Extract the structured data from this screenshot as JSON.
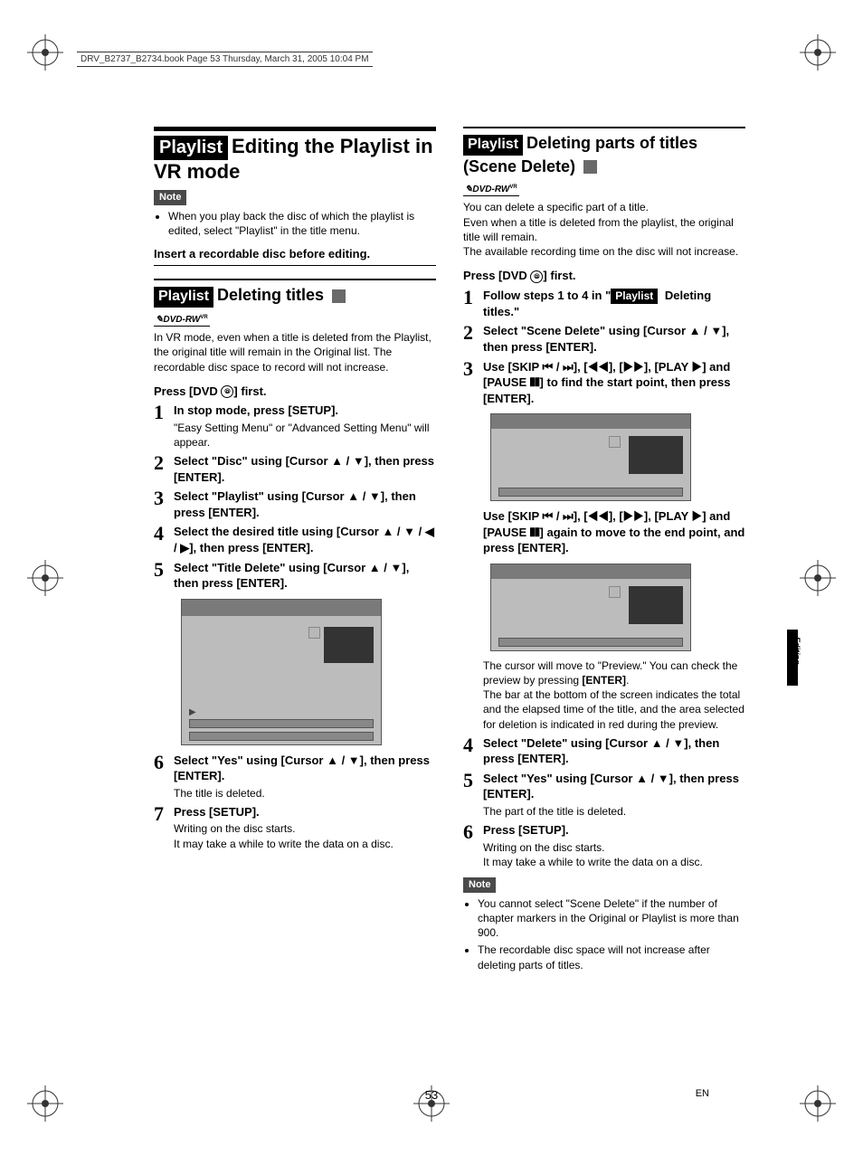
{
  "header_line": "DRV_B2737_B2734.book  Page 53  Thursday, March 31, 2005  10:04 PM",
  "footer": {
    "pagenum": "53",
    "lang": "EN"
  },
  "side_tab": "Editing",
  "left": {
    "title_badge": "Playlist",
    "title": "Editing the Playlist in VR mode",
    "note_label": "Note",
    "note_bullets": [
      "When you play back the disc of which the playlist is edited, select \"Playlist\" in the title menu."
    ],
    "insert_disc": "Insert a recordable disc before editing.",
    "sub_badge": "Playlist",
    "sub_title": "Deleting titles",
    "media_label": "DVD-RW",
    "media_mode": "VR",
    "vrmode_text": "In VR mode, even when a title is deleted from the Playlist, the original title will remain in the Original list. The recordable disc space to record will not increase.",
    "press_dvd": "Press [DVD ⦿] first.",
    "steps": [
      {
        "n": "1",
        "head": "In stop mode, press [SETUP].",
        "sub": "\"Easy Setting Menu\" or \"Advanced Setting Menu\" will appear."
      },
      {
        "n": "2",
        "head": "Select \"Disc\" using [Cursor ▲ / ▼], then press [ENTER].",
        "sub": ""
      },
      {
        "n": "3",
        "head": "Select \"Playlist\" using [Cursor ▲ / ▼], then press [ENTER].",
        "sub": ""
      },
      {
        "n": "4",
        "head": "Select the desired title using [Cursor ▲ / ▼ / ◀ / ▶], then press [ENTER].",
        "sub": ""
      },
      {
        "n": "5",
        "head": "Select \"Title Delete\" using [Cursor ▲ / ▼], then press [ENTER].",
        "sub": ""
      },
      {
        "n": "6",
        "head": "Select \"Yes\" using [Cursor ▲ / ▼], then press [ENTER].",
        "sub": "The title is deleted."
      },
      {
        "n": "7",
        "head": "Press [SETUP].",
        "sub": "Writing on the disc starts.\nIt may take a while to write the data on a disc."
      }
    ]
  },
  "right": {
    "title_badge": "Playlist",
    "title": "Deleting parts of titles (Scene Delete)",
    "media_label": "DVD-RW",
    "media_mode": "VR",
    "intro1": "You can delete a specific part of a title.",
    "intro2": "Even when a title is deleted from the playlist, the original title will remain.",
    "intro3": "The available recording time on the disc will not increase.",
    "press_dvd": "Press [DVD ⦿] first.",
    "steps_a": [
      {
        "n": "1",
        "head_pre": "Follow steps 1 to 4 in \"",
        "head_badge": "Playlist",
        "head_post": " Deleting titles.\""
      },
      {
        "n": "2",
        "head": "Select \"Scene Delete\" using [Cursor ▲ / ▼], then press [ENTER].",
        "sub": ""
      },
      {
        "n": "3",
        "head": "Use [SKIP ⏮ / ⏭], [◀◀], [▶▶], [PLAY ▶] and [PAUSE ❚❚] to find the start point, then press [ENTER].",
        "sub": ""
      }
    ],
    "mid_instr": "Use [SKIP ⏮ / ⏭], [◀◀], [▶▶], [PLAY ▶] and [PAUSE ❚❚] again to move to the end point, and press [ENTER].",
    "post_pre": "The cursor will move to \"Preview.\"  You can check the preview by pressing ",
    "post_bold": "[ENTER]",
    "post_post": ".",
    "post2": "The bar at the bottom of the screen indicates the total and the elapsed time of the title, and the area selected for deletion is indicated in red during the preview.",
    "steps_b": [
      {
        "n": "4",
        "head": "Select \"Delete\" using [Cursor ▲ / ▼], then press [ENTER].",
        "sub": ""
      },
      {
        "n": "5",
        "head": "Select \"Yes\" using [Cursor ▲ / ▼], then press [ENTER].",
        "sub": "The part of the title is deleted."
      },
      {
        "n": "6",
        "head": "Press [SETUP].",
        "sub": "Writing on the disc starts.\nIt may take a while to write the data on a disc."
      }
    ],
    "note_label": "Note",
    "note_bullets": [
      "You cannot select \"Scene Delete\" if the number of chapter markers in the Original or Playlist is more than 900.",
      "The recordable disc space will not increase after deleting parts of titles."
    ]
  }
}
